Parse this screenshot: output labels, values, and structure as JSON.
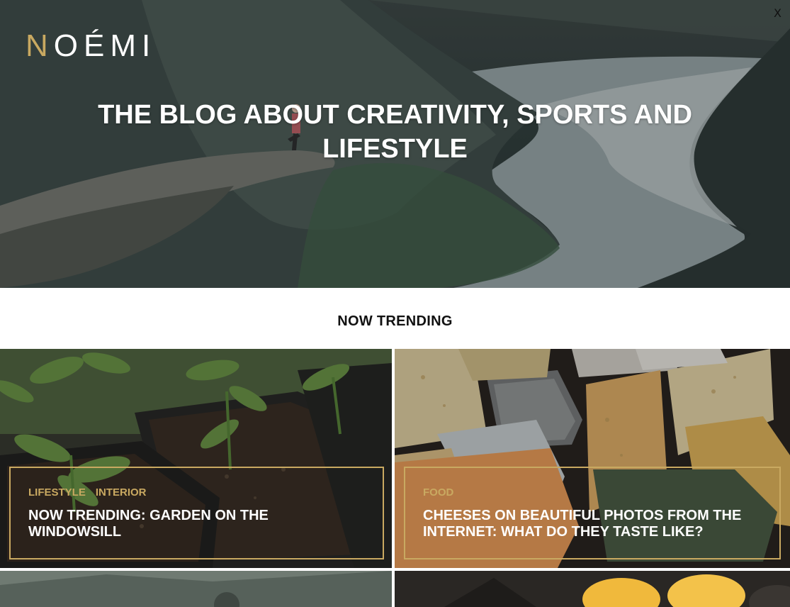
{
  "site": {
    "logo_first": "N",
    "logo_rest": "OÉMI",
    "close_label": "X",
    "accent_color": "#c9a961"
  },
  "hero": {
    "title": "THE BLOG ABOUT CREATIVITY, SPORTS AND LIFESTYLE"
  },
  "trending": {
    "heading": "NOW TRENDING",
    "cards": [
      {
        "categories": [
          "LIFESTYLE",
          "INTERIOR"
        ],
        "title": "NOW TRENDING: GARDEN ON THE WINDOWSILL"
      },
      {
        "categories": [
          "FOOD"
        ],
        "title": "CHEESES ON BEAUTIFUL PHOTOS FROM THE INTERNET: WHAT DO THEY TASTE LIKE?"
      }
    ]
  }
}
